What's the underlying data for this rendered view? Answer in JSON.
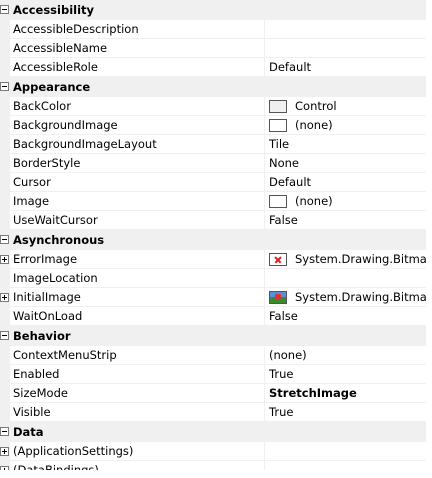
{
  "categories": [
    {
      "label": "Accessibility",
      "expander": "collapse",
      "props": [
        {
          "name": "AccessibleDescription",
          "value": ""
        },
        {
          "name": "AccessibleName",
          "value": ""
        },
        {
          "name": "AccessibleRole",
          "value": "Default"
        }
      ]
    },
    {
      "label": "Appearance",
      "expander": "collapse",
      "props": [
        {
          "name": "BackColor",
          "value": "Control",
          "swatch": "control"
        },
        {
          "name": "BackgroundImage",
          "value": "(none)",
          "swatch": "white"
        },
        {
          "name": "BackgroundImageLayout",
          "value": "Tile"
        },
        {
          "name": "BorderStyle",
          "value": "None"
        },
        {
          "name": "Cursor",
          "value": "Default"
        },
        {
          "name": "Image",
          "value": "(none)",
          "swatch": "white"
        },
        {
          "name": "UseWaitCursor",
          "value": "False"
        }
      ]
    },
    {
      "label": "Asynchronous",
      "expander": "collapse",
      "props": [
        {
          "name": "ErrorImage",
          "value": "System.Drawing.Bitmap",
          "swatch": "error",
          "expandable": true
        },
        {
          "name": "ImageLocation",
          "value": ""
        },
        {
          "name": "InitialImage",
          "value": "System.Drawing.Bitmap",
          "swatch": "init",
          "expandable": true
        },
        {
          "name": "WaitOnLoad",
          "value": "False"
        }
      ]
    },
    {
      "label": "Behavior",
      "expander": "collapse",
      "props": [
        {
          "name": "ContextMenuStrip",
          "value": "(none)"
        },
        {
          "name": "Enabled",
          "value": "True"
        },
        {
          "name": "SizeMode",
          "value": "StretchImage",
          "bold": true
        },
        {
          "name": "Visible",
          "value": "True"
        }
      ]
    },
    {
      "label": "Data",
      "expander": "collapse",
      "props": [
        {
          "name": "(ApplicationSettings)",
          "value": "",
          "expandable": true
        },
        {
          "name": "(DataBindings)",
          "value": "",
          "expandable": true
        }
      ]
    }
  ]
}
